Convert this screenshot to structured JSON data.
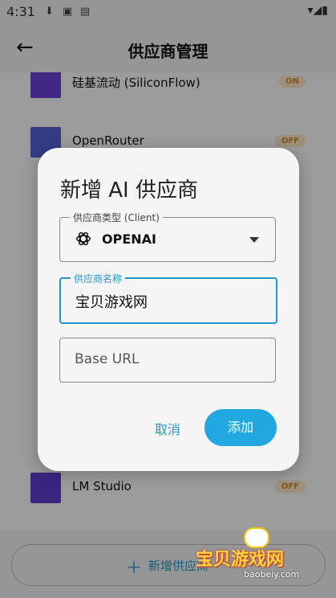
{
  "status_bar": {
    "time": "4:31",
    "right_icons": "▾◢▮"
  },
  "appbar": {
    "title": "供应商管理"
  },
  "list": {
    "items": [
      {
        "name": "硅基流动 (SiliconFlow)",
        "badge": "ON",
        "logo_color": "#6b3fd6"
      },
      {
        "name": "OpenRouter",
        "badge": "OFF",
        "logo_color": "#5563d6"
      },
      {
        "name": "LM Studio",
        "badge": "OFF",
        "logo_color": "#5b3fd0"
      }
    ],
    "add_button_label": "新增供应商"
  },
  "dialog": {
    "title": "新增 AI 供应商",
    "provider_type": {
      "label": "供应商类型 (Client)",
      "value": "OPENAI"
    },
    "provider_name": {
      "label": "供应商名称",
      "value": "宝贝游戏网"
    },
    "base_url": {
      "placeholder": "Base URL"
    },
    "cancel_label": "取消",
    "add_label": "添加"
  },
  "watermark": {
    "text_cn": "宝贝游戏网",
    "text_en": "baobeiy.com"
  },
  "colors": {
    "accent": "#22a8e0",
    "badge_bg": "#fde7c9",
    "badge_text": "#d08a2c"
  }
}
